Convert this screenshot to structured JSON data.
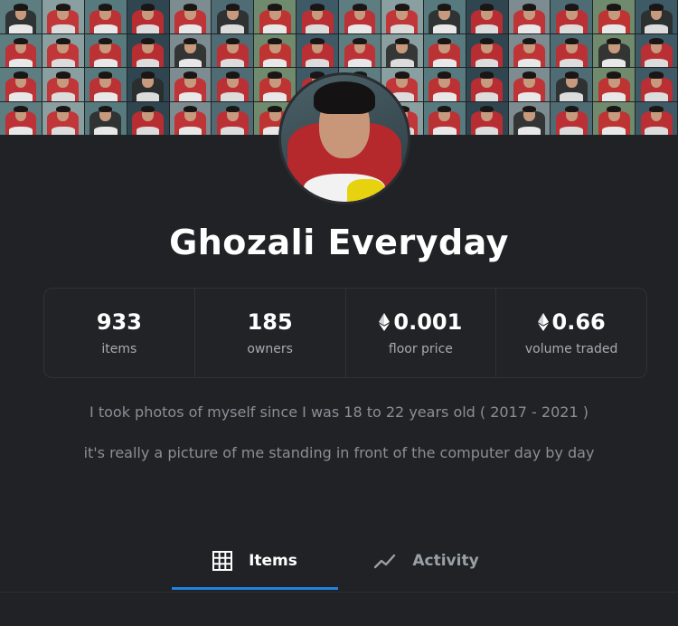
{
  "collection": {
    "name": "Ghozali Everyday"
  },
  "stats": [
    {
      "value": "933",
      "label": "items",
      "eth": false
    },
    {
      "value": "185",
      "label": "owners",
      "eth": false
    },
    {
      "value": "0.001",
      "label": "floor price",
      "eth": true
    },
    {
      "value": "0.66",
      "label": "volume traded",
      "eth": true
    }
  ],
  "description": {
    "line1": "I took photos of myself since I was 18 to 22 years old ( 2017 - 2021 )",
    "line2": "it's really a picture of me standing in front of the computer day by day"
  },
  "tabs": [
    {
      "label": "Items",
      "icon": "grid-icon",
      "active": true
    },
    {
      "label": "Activity",
      "icon": "activity-chart-icon",
      "active": false
    }
  ],
  "colors": {
    "background": "#202225",
    "accent": "#2081e2",
    "muted_text": "#8a8f96"
  },
  "icons": {
    "eth": "ethereum-icon"
  }
}
